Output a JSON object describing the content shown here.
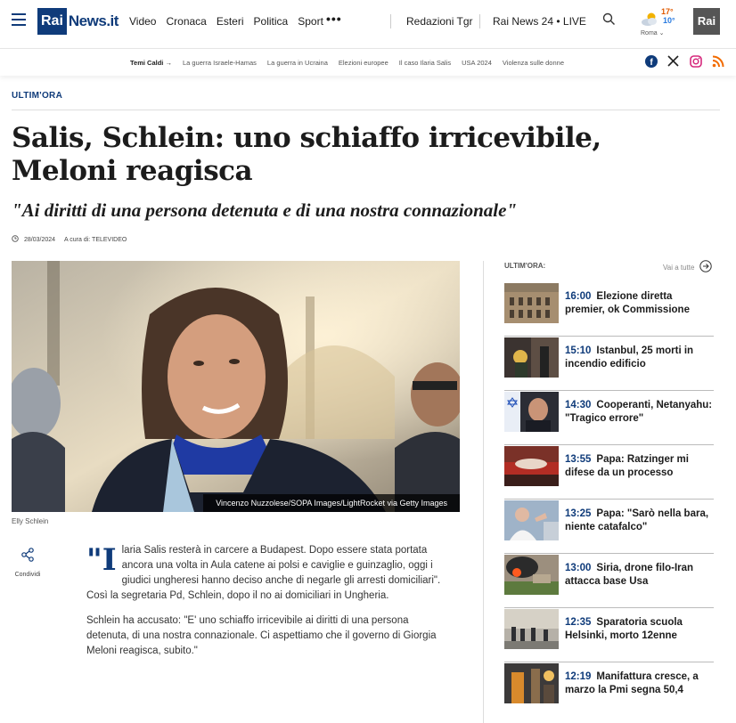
{
  "header": {
    "logo_rai": "Rai",
    "logo_news": "News.it",
    "nav": [
      "Video",
      "Cronaca",
      "Esteri",
      "Politica",
      "Sport"
    ],
    "more": "•••",
    "redazioni": "Redazioni Tgr",
    "live": "Rai News 24 • LIVE",
    "weather": {
      "hi": "17°",
      "lo": "10°",
      "city": "Roma ⌄"
    },
    "rai_badge": "Rai"
  },
  "subnav": {
    "topics": [
      "Temi Caldi →",
      "La guerra Israele-Hamas",
      "La guerra in Ucraina",
      "Elezioni europee",
      "Il caso Ilaria Salis",
      "USA 2024",
      "Violenza sulle donne"
    ],
    "socials": [
      "facebook-icon",
      "x-icon",
      "instagram-icon",
      "rss-icon"
    ]
  },
  "article": {
    "tag": "ULTIM'ORA",
    "headline": "Salis, Schlein: uno schiaffo irricevibile, Meloni reagisca",
    "subhead": "\"Ai diritti di una persona detenuta e di una nostra connazionale\"",
    "date": "28/03/2024",
    "author": "A cura di: TELEVIDEO",
    "photo_credit": "Vincenzo Nuzzolese/SOPA Images/LightRocket via Getty Images",
    "photo_label": "Elly Schlein",
    "share_label": "Condividi",
    "dropcap": "\"I",
    "paragraph1": "laria Salis resterà in carcere a Budapest. Dopo essere stata portata ancora una volta in Aula catene ai polsi e caviglie e guinzaglio, oggi i giudici ungheresi hanno deciso anche di negarle gli arresti domiciliari\". Così la segretaria Pd, Schlein, dopo il no ai domiciliari in Ungheria.",
    "paragraph2": "Schlein ha accusato: \"E' uno schiaffo irricevibile ai diritti di una persona detenuta, di una nostra connazionale. Ci aspettiamo che il governo di Giorgia Meloni reagisca, subito.\""
  },
  "sidebar": {
    "title": "ULTIM'ORA:",
    "see_all": "Vai a tutte",
    "items": [
      {
        "time": "16:00",
        "text": "Elezione diretta premier, ok Commissione"
      },
      {
        "time": "15:10",
        "text": "Istanbul, 25 morti in incendio edificio"
      },
      {
        "time": "14:30",
        "text": "Cooperanti, Netanyahu: \"Tragico errore\""
      },
      {
        "time": "13:55",
        "text": "Papa: Ratzinger mi difese da un processo"
      },
      {
        "time": "13:25",
        "text": "Papa: \"Sarò nella bara, niente catafalco\""
      },
      {
        "time": "13:00",
        "text": "Siria, drone filo-Iran attacca base Usa"
      },
      {
        "time": "12:35",
        "text": "Sparatoria scuola Helsinki, morto 12enne"
      },
      {
        "time": "12:19",
        "text": "Manifattura cresce, a marzo la Pmi segna 50,4"
      }
    ]
  }
}
